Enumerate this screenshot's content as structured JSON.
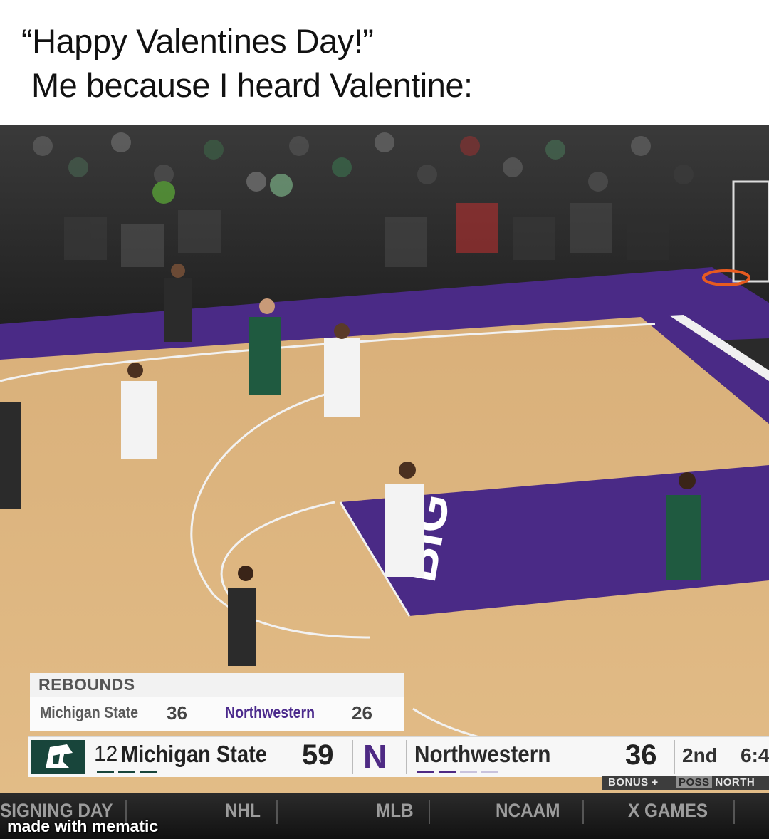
{
  "caption": {
    "line1": "“Happy Valentines Day!”",
    "line2": "Me because I heard Valentine:"
  },
  "overlay": {
    "rebounds": {
      "title": "REBOUNDS",
      "team_a": "Michigan State",
      "team_a_value": "36",
      "team_b": "Northwestern",
      "team_b_value": "26"
    },
    "scorebug": {
      "team_a_rank": "12",
      "team_a_name": "Michigan State",
      "team_a_score": "59",
      "team_b_logo": "N",
      "team_b_name": "Northwestern",
      "team_b_score": "36",
      "period": "2nd",
      "clock": "6:4",
      "bonus_text": "BONUS +",
      "poss_label": "POSS",
      "poss_team": "NORTH"
    },
    "ticker": [
      "SIGNING DAY",
      "NHL",
      "MLB",
      "NCAAM",
      "X GAMES"
    ],
    "watermark": "made with mematic",
    "colors": {
      "court_purple": "#4a2a86",
      "michigan_green": "#18453b",
      "northwestern_purple": "#4e2a84"
    }
  }
}
